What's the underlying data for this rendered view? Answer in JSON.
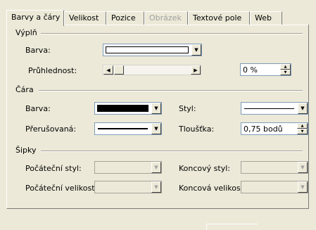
{
  "tabs": [
    {
      "label": "Barvy a čáry",
      "state": "active"
    },
    {
      "label": "Velikost",
      "state": "normal"
    },
    {
      "label": "Pozice",
      "state": "normal"
    },
    {
      "label": "Obrázek",
      "state": "disabled"
    },
    {
      "label": "Textové pole",
      "state": "normal"
    },
    {
      "label": "Web",
      "state": "normal"
    }
  ],
  "fill": {
    "title": "Výplň",
    "color_label": "Barva:",
    "transparency_label": "Průhlednost:",
    "transparency_value": "0 %",
    "color_value": "#ffffff"
  },
  "line": {
    "title": "Čára",
    "color_label": "Barva:",
    "color_value": "#000000",
    "dashed_label": "Přerušovaná:",
    "style_label": "Styl:",
    "weight_label": "Tloušťka:",
    "weight_value": "0,75 bodů"
  },
  "arrows": {
    "title": "Šipky",
    "begin_style_label": "Počáteční styl:",
    "begin_size_label": "Počáteční velikost:",
    "end_style_label": "Koncový styl:",
    "end_size_label": "Koncová velikost:"
  },
  "icons": {
    "dropdown": "chevron-down-icon",
    "scroll_left": "arrow-left-icon",
    "scroll_right": "arrow-right-icon",
    "spin_up": "arrow-up-icon",
    "spin_down": "arrow-down-icon"
  }
}
